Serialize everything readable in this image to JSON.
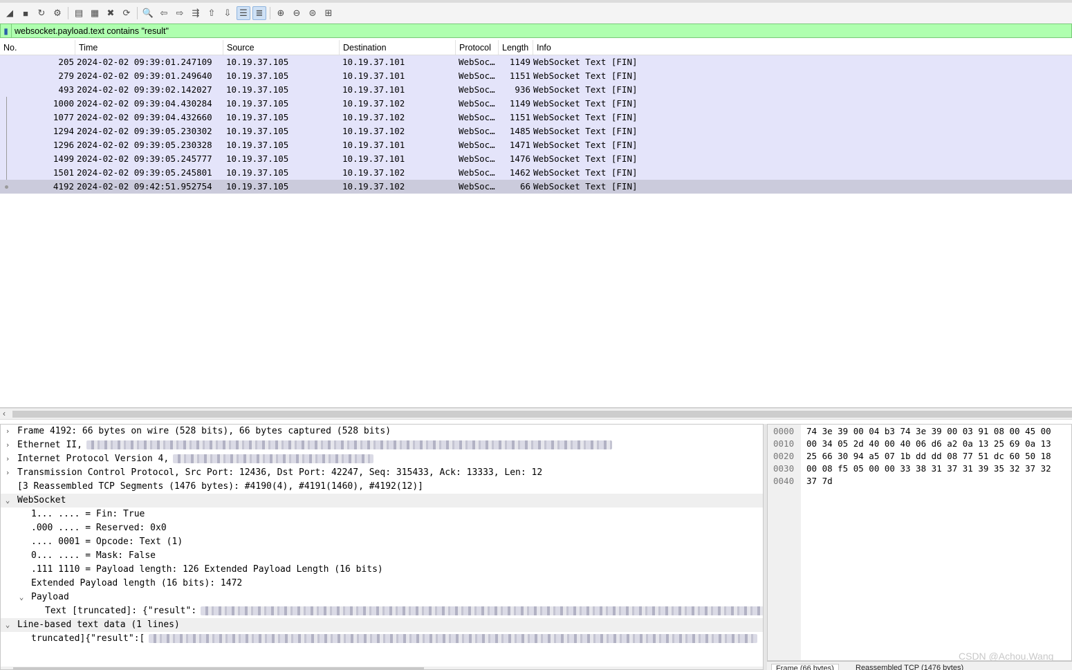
{
  "toolbar": {
    "buttons": [
      {
        "name": "start-capture-icon",
        "glyph": "◢"
      },
      {
        "name": "stop-capture-icon",
        "glyph": "■"
      },
      {
        "name": "restart-capture-icon",
        "glyph": "↻"
      },
      {
        "name": "capture-options-icon",
        "glyph": "⚙"
      },
      {
        "name": "open-file-icon",
        "glyph": "▤"
      },
      {
        "name": "save-file-icon",
        "glyph": "▦"
      },
      {
        "name": "close-file-icon",
        "glyph": "✖"
      },
      {
        "name": "reload-file-icon",
        "glyph": "⟳"
      },
      {
        "name": "find-packet-icon",
        "glyph": "🔍"
      },
      {
        "name": "go-back-icon",
        "glyph": "⇦"
      },
      {
        "name": "go-forward-icon",
        "glyph": "⇨"
      },
      {
        "name": "go-to-packet-icon",
        "glyph": "⇶"
      },
      {
        "name": "first-packet-icon",
        "glyph": "⇧"
      },
      {
        "name": "last-packet-icon",
        "glyph": "⇩"
      },
      {
        "name": "autoscroll-icon",
        "glyph": "☰",
        "active": true
      },
      {
        "name": "colorize-icon",
        "glyph": "≣",
        "active": true
      },
      {
        "name": "zoom-in-icon",
        "glyph": "⊕"
      },
      {
        "name": "zoom-out-icon",
        "glyph": "⊖"
      },
      {
        "name": "normal-size-icon",
        "glyph": "⊜"
      },
      {
        "name": "resize-columns-icon",
        "glyph": "⊞"
      }
    ]
  },
  "filter": {
    "value": "websocket.payload.text contains \"result\""
  },
  "packet_list": {
    "columns": [
      "No.",
      "Time",
      "Source",
      "Destination",
      "Protocol",
      "Length",
      "Info"
    ],
    "rows": [
      {
        "no": "205",
        "time": "2024-02-02 09:39:01.247109",
        "src": "10.19.37.105",
        "dst": "10.19.37.101",
        "proto": "WebSoc…",
        "len": "1149",
        "info": "WebSocket Text [FIN]"
      },
      {
        "no": "279",
        "time": "2024-02-02 09:39:01.249640",
        "src": "10.19.37.105",
        "dst": "10.19.37.101",
        "proto": "WebSoc…",
        "len": "1151",
        "info": "WebSocket Text [FIN]"
      },
      {
        "no": "493",
        "time": "2024-02-02 09:39:02.142027",
        "src": "10.19.37.105",
        "dst": "10.19.37.101",
        "proto": "WebSoc…",
        "len": "936",
        "info": "WebSocket Text [FIN]"
      },
      {
        "no": "1000",
        "time": "2024-02-02 09:39:04.430284",
        "src": "10.19.37.105",
        "dst": "10.19.37.102",
        "proto": "WebSoc…",
        "len": "1149",
        "info": "WebSocket Text [FIN]"
      },
      {
        "no": "1077",
        "time": "2024-02-02 09:39:04.432660",
        "src": "10.19.37.105",
        "dst": "10.19.37.102",
        "proto": "WebSoc…",
        "len": "1151",
        "info": "WebSocket Text [FIN]"
      },
      {
        "no": "1294",
        "time": "2024-02-02 09:39:05.230302",
        "src": "10.19.37.105",
        "dst": "10.19.37.102",
        "proto": "WebSoc…",
        "len": "1485",
        "info": "WebSocket Text [FIN]"
      },
      {
        "no": "1296",
        "time": "2024-02-02 09:39:05.230328",
        "src": "10.19.37.105",
        "dst": "10.19.37.101",
        "proto": "WebSoc…",
        "len": "1471",
        "info": "WebSocket Text [FIN]"
      },
      {
        "no": "1499",
        "time": "2024-02-02 09:39:05.245777",
        "src": "10.19.37.105",
        "dst": "10.19.37.101",
        "proto": "WebSoc…",
        "len": "1476",
        "info": "WebSocket Text [FIN]"
      },
      {
        "no": "1501",
        "time": "2024-02-02 09:39:05.245801",
        "src": "10.19.37.105",
        "dst": "10.19.37.102",
        "proto": "WebSoc…",
        "len": "1462",
        "info": "WebSocket Text [FIN]"
      },
      {
        "no": "4192",
        "time": "2024-02-02 09:42:51.952754",
        "src": "10.19.37.105",
        "dst": "10.19.37.102",
        "proto": "WebSoc…",
        "len": "66",
        "info": "WebSocket Text [FIN]",
        "selected": true
      }
    ]
  },
  "details": {
    "lines": [
      {
        "level": 0,
        "toggle": "collapsed",
        "text": "Frame 4192: 66 bytes on wire (528 bits), 66 bytes captured (528 bits)"
      },
      {
        "level": 0,
        "toggle": "collapsed",
        "text": "Ethernet II,",
        "blurred": true
      },
      {
        "level": 0,
        "toggle": "collapsed",
        "text": "Internet Protocol Version 4,",
        "blurred": true
      },
      {
        "level": 0,
        "toggle": "collapsed",
        "text": "Transmission Control Protocol, Src Port: 12436, Dst Port: 42247, Seq: 315433, Ack: 13333, Len: 12"
      },
      {
        "level": 0,
        "toggle": "none",
        "text": "[3 Reassembled TCP Segments (1476 bytes): #4190(4), #4191(1460), #4192(12)]"
      },
      {
        "level": 0,
        "toggle": "expanded",
        "text": "WebSocket"
      },
      {
        "level": 1,
        "toggle": "none",
        "text": "1... .... = Fin: True"
      },
      {
        "level": 1,
        "toggle": "none",
        "text": ".000 .... = Reserved: 0x0"
      },
      {
        "level": 1,
        "toggle": "none",
        "text": ".... 0001 = Opcode: Text (1)"
      },
      {
        "level": 1,
        "toggle": "none",
        "text": "0... .... = Mask: False"
      },
      {
        "level": 1,
        "toggle": "none",
        "text": ".111 1110 = Payload length: 126 Extended Payload Length (16 bits)"
      },
      {
        "level": 1,
        "toggle": "none",
        "text": "Extended Payload length (16 bits): 1472"
      },
      {
        "level": 1,
        "toggle": "expanded",
        "text": "Payload"
      },
      {
        "level": 2,
        "toggle": "none",
        "text": "Text [truncated]: {\"result\":",
        "blurred": true
      },
      {
        "level": 0,
        "toggle": "expanded",
        "text": "Line-based text data (1 lines)"
      },
      {
        "level": 1,
        "toggle": "none",
        "text": "truncated]{\"result\":[",
        "blurred": true
      }
    ]
  },
  "bytes": {
    "rows": [
      {
        "offset": "0000",
        "hex": "74 3e 39 00 04 b3 74 3e  39 00 03 91 08 00 45 00"
      },
      {
        "offset": "0010",
        "hex": "00 34 05 2d 40 00 40 06  d6 a2 0a 13 25 69 0a 13"
      },
      {
        "offset": "0020",
        "hex": "25 66 30 94 a5 07 1b dd  dd 08 77 51 dc 60 50 18"
      },
      {
        "offset": "0030",
        "hex": "00 08 f5 05 00 00 33 38  31 37 31 39 35 32 37 32"
      },
      {
        "offset": "0040",
        "hex": "37 7d"
      }
    ],
    "tabs": [
      "Frame (66 bytes)",
      "Reassembled TCP (1476 bytes)"
    ]
  },
  "watermark": "CSDN @Achou.Wang"
}
